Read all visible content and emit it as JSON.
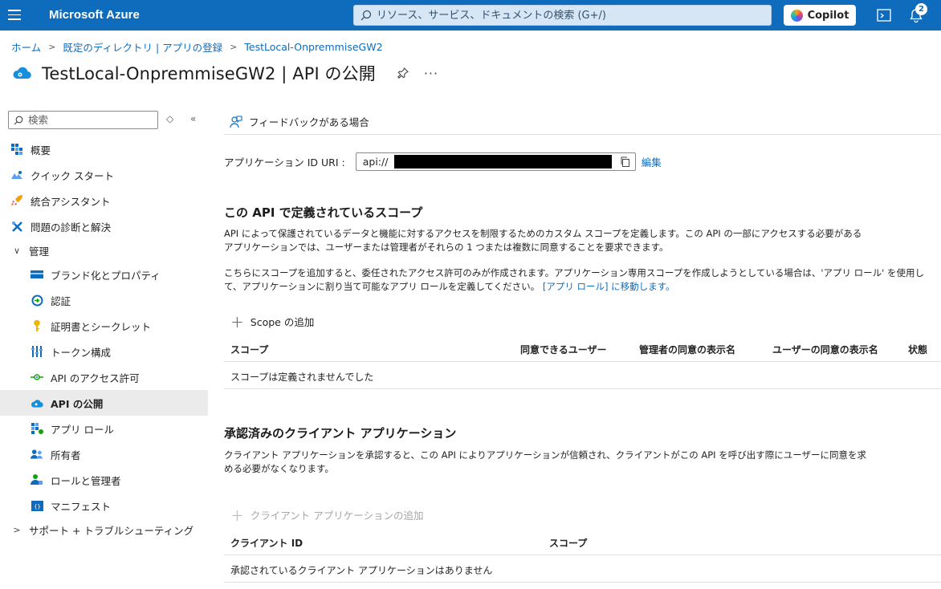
{
  "topbar": {
    "brand": "Microsoft Azure",
    "search_placeholder": "リソース、サービス、ドキュメントの検索 (G+/)",
    "copilot_label": "Copilot",
    "notification_count": "2",
    "bg_color": "#0f6cbd"
  },
  "breadcrumb": {
    "items": [
      "ホーム",
      "既定のディレクトリ | アプリの登録",
      "TestLocal-OnpremmiseGW2"
    ]
  },
  "page": {
    "title": "TestLocal-OnpremmiseGW2 | API の公開",
    "more": "···"
  },
  "sidebar": {
    "search_placeholder": "検索",
    "items": [
      {
        "label": "概要",
        "icon": "overview-icon"
      },
      {
        "label": "クイック スタート",
        "icon": "quickstart-icon"
      },
      {
        "label": "統合アシスタント",
        "icon": "rocket-icon"
      },
      {
        "label": "問題の診断と解決",
        "icon": "wrench-icon"
      },
      {
        "label": "管理",
        "icon": "chevron-down-icon"
      },
      {
        "label": "ブランド化とプロパティ",
        "icon": "branding-icon"
      },
      {
        "label": "認証",
        "icon": "authentication-icon"
      },
      {
        "label": "証明書とシークレット",
        "icon": "key-icon"
      },
      {
        "label": "トークン構成",
        "icon": "token-icon"
      },
      {
        "label": "API のアクセス許可",
        "icon": "api-permission-icon"
      },
      {
        "label": "API の公開",
        "icon": "cloud-icon"
      },
      {
        "label": "アプリ ロール",
        "icon": "app-roles-icon"
      },
      {
        "label": "所有者",
        "icon": "owners-icon"
      },
      {
        "label": "ロールと管理者",
        "icon": "roles-admin-icon"
      },
      {
        "label": "マニフェスト",
        "icon": "manifest-icon"
      },
      {
        "label": "サポート + トラブルシューティング",
        "icon": "chevron-right-icon"
      }
    ]
  },
  "main": {
    "feedback_label": "フィードバックがある場合",
    "uri_label": "アプリケーション ID URI :",
    "uri_value": "api://",
    "edit_label": "編集",
    "scopes": {
      "title": "この API で定義されているスコープ",
      "desc1": "API によって保護されているデータと機能に対するアクセスを制限するためのカスタム スコープを定義します。この API の一部にアクセスする必要があるアプリケーションでは、ユーザーまたは管理者がそれらの 1 つまたは複数に同意することを要求できます。",
      "desc2": "こちらにスコープを追加すると、委任されたアクセス許可のみが作成されます。アプリケーション専用スコープを作成しようとしている場合は、'アプリ ロール' を使用して、アプリケーションに割り当て可能なアプリ ロールを定義してください。",
      "desc2_link": "[アプリ ロール] に移動します。",
      "add_label": "Scope の追加",
      "columns": [
        "スコープ",
        "同意できるユーザー",
        "管理者の同意の表示名",
        "ユーザーの同意の表示名",
        "状態"
      ],
      "empty": "スコープは定義されませんでした"
    },
    "clients": {
      "title": "承認済みのクライアント アプリケーション",
      "desc": "クライアント アプリケーションを承認すると、この API によりアプリケーションが信頼され、クライアントがこの API を呼び出す際にユーザーに同意を求める必要がなくなります。",
      "add_label": "クライアント アプリケーションの追加",
      "columns": [
        "クライアント ID",
        "スコープ"
      ],
      "empty": "承認されているクライアント アプリケーションはありません"
    }
  }
}
